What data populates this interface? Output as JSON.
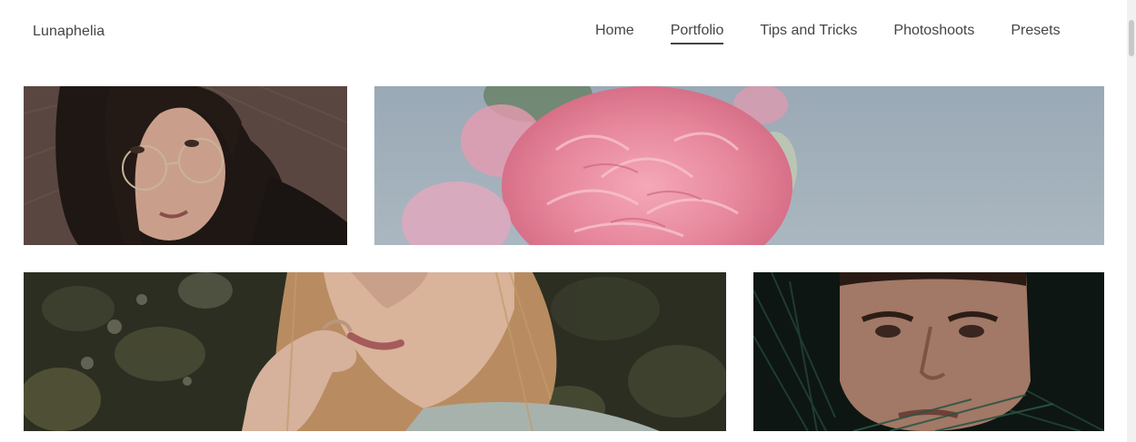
{
  "header": {
    "brand": "Lunaphelia",
    "nav": [
      {
        "label": "Home",
        "active": false
      },
      {
        "label": "Portfolio",
        "active": true
      },
      {
        "label": "Tips and Tricks",
        "active": false
      },
      {
        "label": "Photoshoots",
        "active": false
      },
      {
        "label": "Presets",
        "active": false
      }
    ]
  },
  "gallery": {
    "photos": [
      {
        "subject": "woman with glasses portrait"
      },
      {
        "subject": "pink peony flower"
      },
      {
        "subject": "blonde woman touching lips"
      },
      {
        "subject": "man face close-up"
      }
    ]
  },
  "colors": {
    "text": "#444444",
    "background": "#ffffff"
  }
}
